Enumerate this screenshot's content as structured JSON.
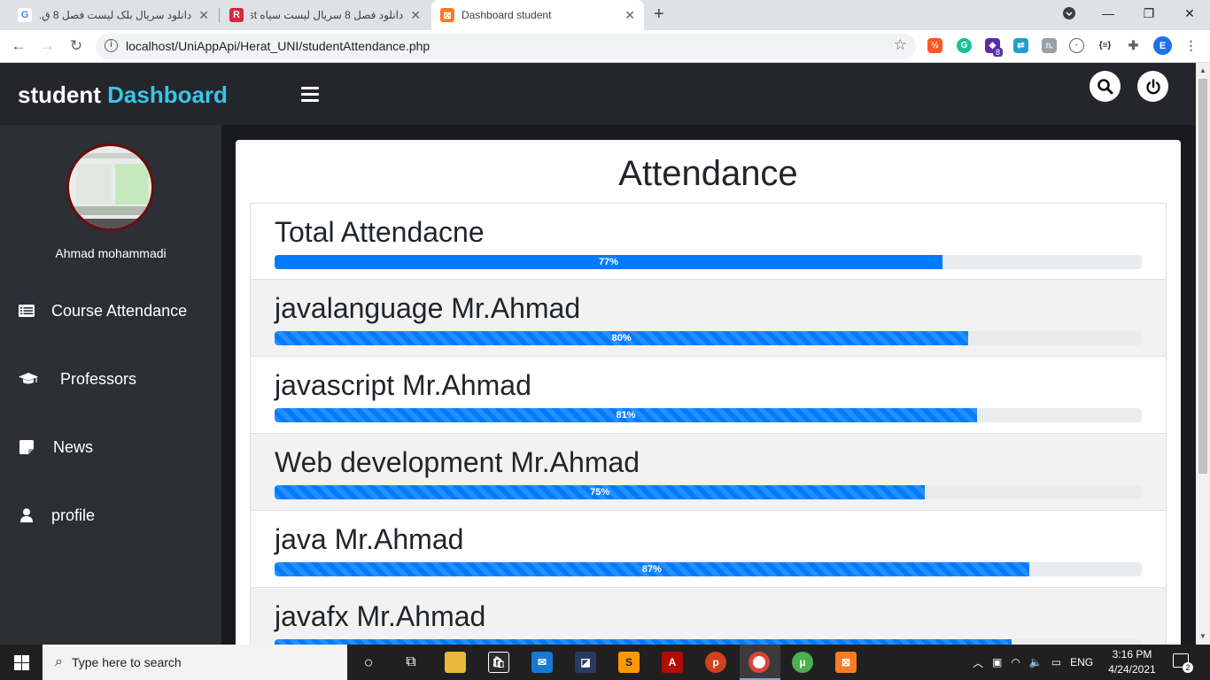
{
  "browser": {
    "tabs": [
      {
        "title": "دانلود سریال بلک لیست فصل 8 ق..."
      },
      {
        "title": "دانلود فصل 8 سریال لیست سیاه st"
      },
      {
        "title": "Dashboard student"
      }
    ],
    "url": "localhost/UniAppApi/Herat_UNI/studentAttendance.php",
    "extension_badge": "8"
  },
  "app": {
    "brand_part1": "student",
    "brand_part2": "Dashboard",
    "user_name": "Ahmad mohammadi",
    "nav": [
      {
        "label": "Course Attendance",
        "icon": "list-icon"
      },
      {
        "label": "Professors",
        "icon": "graduation-cap-icon"
      },
      {
        "label": "News",
        "icon": "note-icon"
      },
      {
        "label": "profile",
        "icon": "user-icon"
      }
    ],
    "page_title": "Attendance",
    "attendance": [
      {
        "label": "Total Attendacne",
        "percent": 77,
        "percent_text": "77%",
        "striped": false
      },
      {
        "label": "javalanguage Mr.Ahmad",
        "percent": 80,
        "percent_text": "80%",
        "striped": true
      },
      {
        "label": "javascript Mr.Ahmad",
        "percent": 81,
        "percent_text": "81%",
        "striped": true
      },
      {
        "label": "Web development Mr.Ahmad",
        "percent": 75,
        "percent_text": "75%",
        "striped": true
      },
      {
        "label": "java Mr.Ahmad",
        "percent": 87,
        "percent_text": "87%",
        "striped": true
      },
      {
        "label": "javafx Mr.Ahmad",
        "percent": 85,
        "percent_text": "",
        "striped": true
      }
    ]
  },
  "taskbar": {
    "search_placeholder": "Type here to search",
    "language": "ENG",
    "time": "3:16 PM",
    "date": "4/24/2021",
    "notification_count": "2"
  },
  "colors": {
    "accent": "#3bc4e8",
    "progress": "#007bff",
    "topbar": "#24262b",
    "sidebar": "#2c2f36"
  }
}
